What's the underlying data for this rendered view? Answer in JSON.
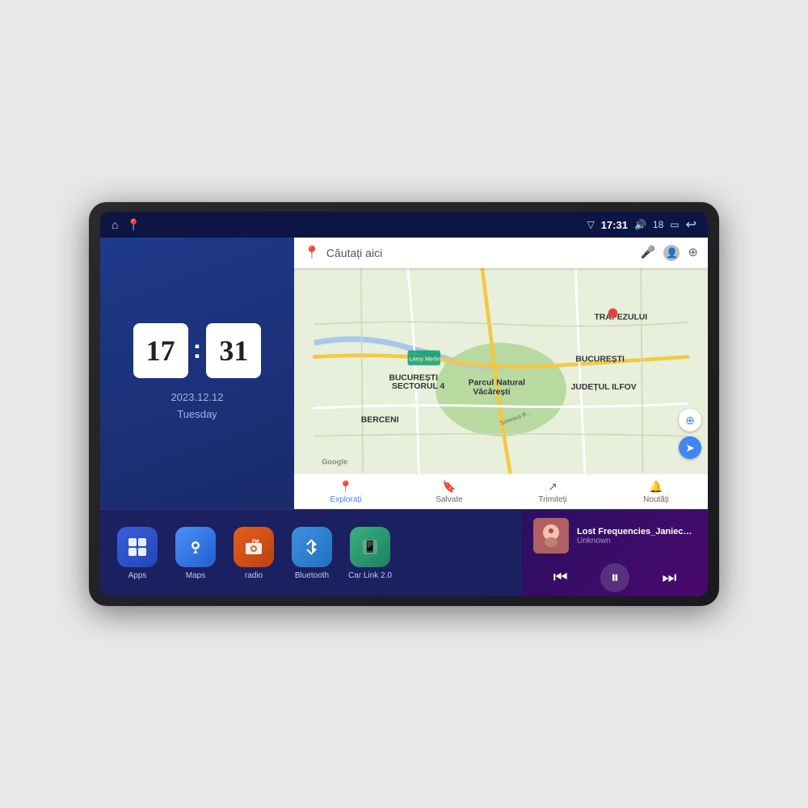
{
  "device": {
    "status_bar": {
      "left_icons": [
        "home-icon",
        "maps-icon"
      ],
      "time": "17:31",
      "signal_icon": "signal-icon",
      "volume_icon": "volume-icon",
      "volume_level": "18",
      "battery_icon": "battery-icon",
      "back_icon": "back-icon"
    },
    "clock_widget": {
      "hours": "17",
      "minutes": "31",
      "date": "2023.12.12",
      "day": "Tuesday"
    },
    "map_widget": {
      "search_placeholder": "Căutați aici",
      "nav_items": [
        {
          "label": "Explorați",
          "active": true
        },
        {
          "label": "Salvate",
          "active": false
        },
        {
          "label": "Trimiteți",
          "active": false
        },
        {
          "label": "Noutăți",
          "active": false
        }
      ],
      "map_labels": [
        "TRAPEZULUI",
        "BUCUREȘTI",
        "JUDEȚUL ILFOV",
        "BERCENI",
        "Parcul Natural Văcărești",
        "Leroy Merlin",
        "BUCUREȘTI SECTORUL 4"
      ]
    },
    "apps": [
      {
        "id": "apps",
        "label": "Apps",
        "icon": "⊞"
      },
      {
        "id": "maps",
        "label": "Maps",
        "icon": "📍"
      },
      {
        "id": "radio",
        "label": "radio",
        "icon": "📻"
      },
      {
        "id": "bluetooth",
        "label": "Bluetooth",
        "icon": "⬡"
      },
      {
        "id": "carlink",
        "label": "Car Link 2.0",
        "icon": "🔗"
      }
    ],
    "music_player": {
      "title": "Lost Frequencies_Janieck Devy-...",
      "artist": "Unknown",
      "controls": {
        "prev": "⏮",
        "play": "⏸",
        "next": "⏭"
      }
    }
  }
}
